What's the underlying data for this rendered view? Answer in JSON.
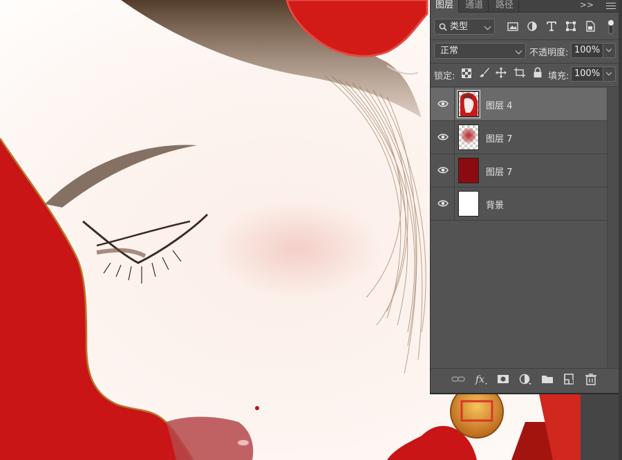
{
  "tabs": [
    {
      "label": "图层",
      "active": true
    },
    {
      "label": "通道",
      "active": false
    },
    {
      "label": "路径",
      "active": false
    }
  ],
  "filter": {
    "kind_label": "类型"
  },
  "blend": {
    "mode": "正常",
    "opacity_label": "不透明度:",
    "opacity_value": "100%"
  },
  "lock": {
    "label": "锁定:",
    "fill_label": "填充:",
    "fill_value": "100%"
  },
  "layers": [
    {
      "name": "图层 4",
      "selected": true,
      "visible": true,
      "thumb": "portrait"
    },
    {
      "name": "图层 7",
      "selected": false,
      "visible": true,
      "thumb": "soft-red-blob"
    },
    {
      "name": "图层 7",
      "selected": false,
      "visible": true,
      "thumb": "dark-red-fill"
    },
    {
      "name": "背景",
      "selected": false,
      "visible": true,
      "thumb": "white-fill"
    }
  ],
  "colors": {
    "panel_bg": "#535353",
    "selected_row": "#6a6a6a",
    "canvas_red": "#cc1515",
    "skin": "#fdf6f2",
    "hair": "#6b4a2e"
  }
}
